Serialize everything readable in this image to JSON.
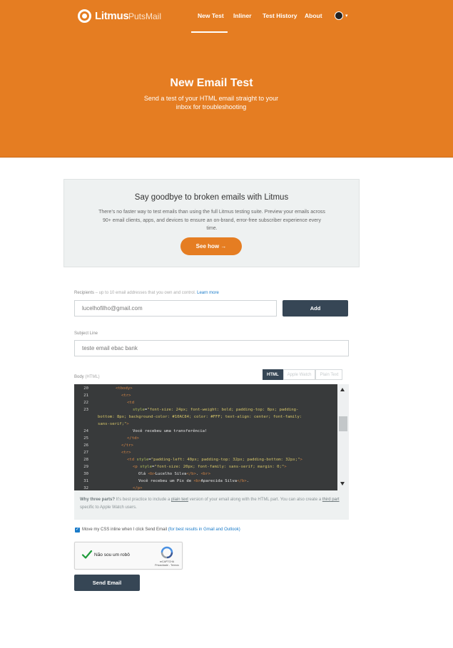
{
  "header": {
    "logo_text": "Litmus",
    "product_name": "PutsMail",
    "nav": [
      "New Test",
      "Inliner",
      "Test History",
      "About"
    ],
    "active_nav": "New Test",
    "profile_caret": "▾"
  },
  "hero": {
    "title": "New Email Test",
    "subtitle": "Send a test of your HTML email straight to your inbox for troubleshooting"
  },
  "promo": {
    "title": "Say goodbye to broken emails with Litmus",
    "text": "There’s no faster way to test emails than using the full Litmus testing suite. Preview your emails across 90+ email clients, apps, and devices to ensure an on-brand, error-free subscriber experience every time.",
    "button_label": "See how →"
  },
  "recipients": {
    "label": "Recipients",
    "hint": " – up to 10 email addresses that you own and control.",
    "link": "Learn more",
    "value": "lucelhofilho@gmail.com",
    "add_label": "Add"
  },
  "subject": {
    "label": "Subject Line",
    "value": "teste email ebac bank"
  },
  "body": {
    "label": "Body",
    "label_hint": " (HTML)",
    "tabs": [
      "HTML",
      "Apple Watch",
      "Plain Text"
    ],
    "active_tab": "HTML",
    "line_numbers": [
      "20",
      "21",
      "22",
      "23",
      "",
      "",
      "24",
      "25",
      "26",
      "27",
      "28",
      "29",
      "30",
      "31",
      "32"
    ]
  },
  "note": {
    "lead": "Why three parts?",
    "text_1": " It’s best practice to include a ",
    "link_1": "plain text",
    "text_2": " version of your email along with the HTML part. You can also create a ",
    "link_2": "third part",
    "text_3": " specific to Apple Watch users."
  },
  "inline_option": {
    "label": "Move my CSS inline when I click Send Email",
    "hint": " (for best results in Gmail and Outlook)",
    "checked": true
  },
  "captcha": {
    "label": "Não sou um robô",
    "brand": "reCAPTCHA",
    "links": "Privacidade - Termos"
  },
  "send_label": "Send Email",
  "colors": {
    "brand_orange": "#e57d22",
    "dark_button": "#364655",
    "link_blue": "#1a7bc9"
  }
}
